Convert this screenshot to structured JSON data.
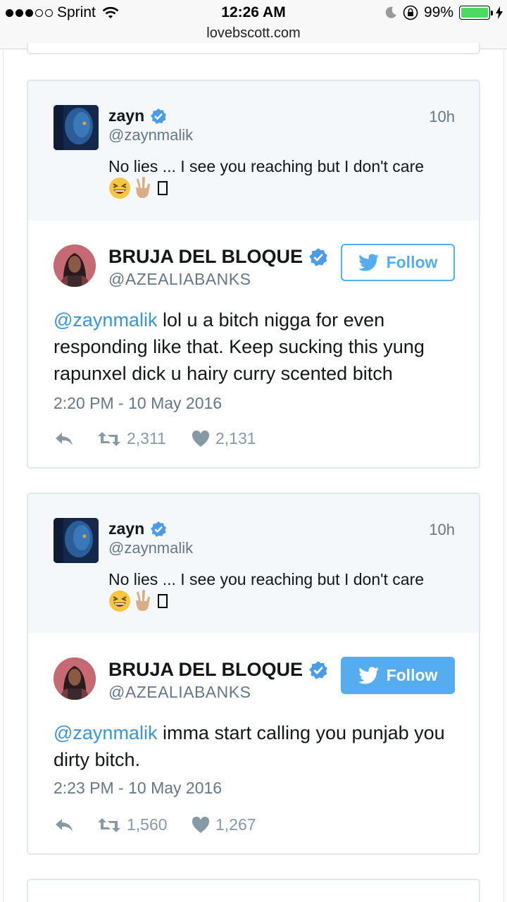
{
  "status_bar": {
    "carrier": "Sprint",
    "time": "12:26 AM",
    "url": "lovebscott.com",
    "battery": "99%",
    "battery_level": 0.99
  },
  "embeds": [
    {
      "reply": {
        "name": "zayn",
        "handle": "@zaynmalik",
        "time": "10h",
        "text": "No lies ... I see you reaching but I don't care"
      },
      "tweet": {
        "name": "BRUJA DEL BLOQUE",
        "handle": "@AZEALIABANKS",
        "follow_label": "Follow",
        "mention": "@zaynmalik",
        "text": " lol u a bitch nigga for even responding like that. Keep sucking this yung rapunxel dick u hairy curry scented bitch",
        "date": "2:20 PM - 10 May 2016",
        "retweets": "2,311",
        "likes": "2,131"
      }
    },
    {
      "reply": {
        "name": "zayn",
        "handle": "@zaynmalik",
        "time": "10h",
        "text": "No lies ... I see you reaching but I don't care"
      },
      "tweet": {
        "name": "BRUJA DEL BLOQUE",
        "handle": "@AZEALIABANKS",
        "follow_label": "Follow",
        "mention": "@zaynmalik",
        "text": " imma start calling you punjab you dirty bitch.",
        "date": "2:23 PM - 10 May 2016",
        "retweets": "1,560",
        "likes": "1,267"
      }
    }
  ],
  "colors": {
    "twitter_blue": "#55acee",
    "mention": "#3b94d9",
    "muted": "#657786",
    "verified": "#4a9ce8"
  },
  "icons": [
    "signal-dots-icon",
    "wifi-icon",
    "moon-icon",
    "rotation-lock-icon",
    "battery-icon",
    "charging-bolt-icon",
    "verified-badge-icon",
    "twitter-bird-icon",
    "reply-icon",
    "retweet-icon",
    "heart-icon"
  ]
}
